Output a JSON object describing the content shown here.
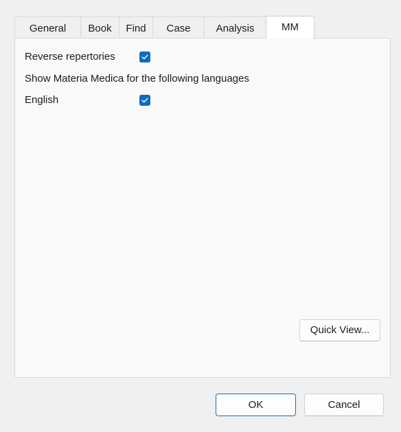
{
  "tabs": [
    {
      "label": "General",
      "active": false
    },
    {
      "label": "Book",
      "active": false
    },
    {
      "label": "Find",
      "active": false
    },
    {
      "label": "Case",
      "active": false
    },
    {
      "label": "Analysis",
      "active": false
    },
    {
      "label": "MM",
      "active": true
    }
  ],
  "mm": {
    "reverse_label": "Reverse repertories",
    "reverse_checked": true,
    "languages_label": "Show Materia Medica for the following languages",
    "english_label": "English",
    "english_checked": true,
    "quick_view_label": "Quick View..."
  },
  "footer": {
    "ok_label": "OK",
    "cancel_label": "Cancel"
  },
  "colors": {
    "accent": "#0f6cbd",
    "dialog_bg": "#f0f0f0",
    "panel_bg": "#f9f9f9"
  },
  "icons": {
    "checkbox_mark": "checkmark-icon"
  }
}
